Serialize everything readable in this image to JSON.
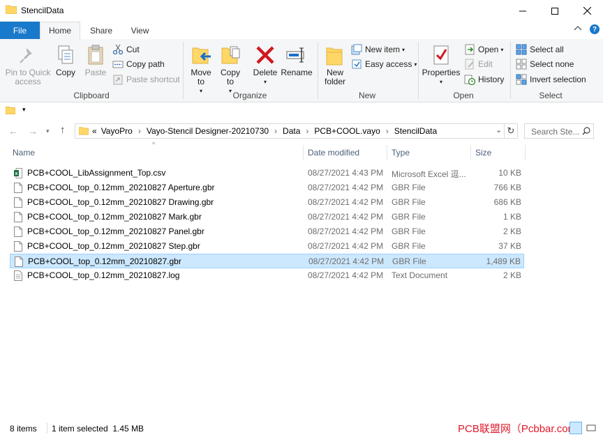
{
  "window": {
    "title": "StencilData"
  },
  "ribbon_tabs": {
    "file": "File",
    "home": "Home",
    "share": "Share",
    "view": "View"
  },
  "clipboard": {
    "pin": "Pin to Quick access",
    "copy": "Copy",
    "paste": "Paste",
    "cut": "Cut",
    "copy_path": "Copy path",
    "paste_shortcut": "Paste shortcut",
    "group": "Clipboard"
  },
  "organize": {
    "move_to": "Move to",
    "copy_to": "Copy to",
    "delete": "Delete",
    "rename": "Rename",
    "group": "Organize"
  },
  "new": {
    "new_folder": "New folder",
    "new_item": "New item",
    "easy_access": "Easy access",
    "group": "New"
  },
  "open": {
    "properties": "Properties",
    "open": "Open",
    "edit": "Edit",
    "history": "History",
    "group": "Open"
  },
  "select": {
    "select_all": "Select all",
    "select_none": "Select none",
    "invert": "Invert selection",
    "group": "Select"
  },
  "address": {
    "overflow": "«",
    "crumbs": [
      "VayoPro",
      "Vayo-Stencil Designer-20210730",
      "Data",
      "PCB+COOL.vayo",
      "StencilData"
    ],
    "search_placeholder": "Search Ste..."
  },
  "columns": {
    "name": "Name",
    "date": "Date modified",
    "type": "Type",
    "size": "Size"
  },
  "files": [
    {
      "name": "PCB+COOL_LibAssignment_Top.csv",
      "date": "08/27/2021 4:43 PM",
      "type": "Microsoft Excel 逗...",
      "size": "10 KB",
      "icon": "excel-icon"
    },
    {
      "name": "PCB+COOL_top_0.12mm_20210827 Aperture.gbr",
      "date": "08/27/2021 4:42 PM",
      "type": "GBR File",
      "size": "766 KB",
      "icon": "file-icon"
    },
    {
      "name": "PCB+COOL_top_0.12mm_20210827 Drawing.gbr",
      "date": "08/27/2021 4:42 PM",
      "type": "GBR File",
      "size": "686 KB",
      "icon": "file-icon"
    },
    {
      "name": "PCB+COOL_top_0.12mm_20210827 Mark.gbr",
      "date": "08/27/2021 4:42 PM",
      "type": "GBR File",
      "size": "1 KB",
      "icon": "file-icon"
    },
    {
      "name": "PCB+COOL_top_0.12mm_20210827 Panel.gbr",
      "date": "08/27/2021 4:42 PM",
      "type": "GBR File",
      "size": "2 KB",
      "icon": "file-icon"
    },
    {
      "name": "PCB+COOL_top_0.12mm_20210827 Step.gbr",
      "date": "08/27/2021 4:42 PM",
      "type": "GBR File",
      "size": "37 KB",
      "icon": "file-icon"
    },
    {
      "name": "PCB+COOL_top_0.12mm_20210827.gbr",
      "date": "08/27/2021 4:42 PM",
      "type": "GBR File",
      "size": "1,489 KB",
      "icon": "file-icon",
      "selected": true
    },
    {
      "name": "PCB+COOL_top_0.12mm_20210827.log",
      "date": "08/27/2021 4:42 PM",
      "type": "Text Document",
      "size": "2 KB",
      "icon": "text-file-icon"
    }
  ],
  "status": {
    "count": "8 items",
    "selection": "1 item selected  1.45 MB"
  },
  "watermark": "PCB联盟网（Pcbbar.com）",
  "colors": {
    "accent": "#1979ca",
    "selection": "#cce8ff",
    "folder": "#ffd766"
  }
}
